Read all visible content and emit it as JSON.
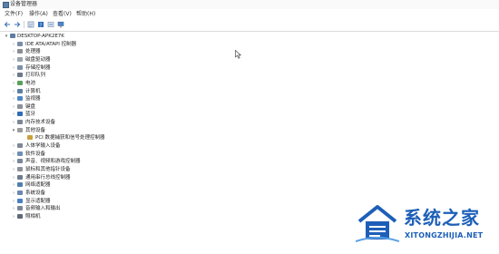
{
  "window": {
    "title": "设备管理器",
    "icon": "device-manager-icon"
  },
  "menu": [
    "文件(F)",
    "操作(A)",
    "查看(V)",
    "帮助(H)"
  ],
  "toolbar": {
    "buttons": [
      "back-arrow-icon",
      "forward-arrow-icon",
      "properties-icon",
      "help-icon",
      "update-driver-icon",
      "monitor-icon"
    ]
  },
  "tree": {
    "root": "DESKTOP-APK2E7K",
    "root_icon": "computer-icon",
    "items": [
      {
        "label": "IDE ATA/ATAPI 控制器",
        "icon": "ide-controller-icon",
        "expanded": false
      },
      {
        "label": "处理器",
        "icon": "processor-icon",
        "expanded": false
      },
      {
        "label": "磁盘驱动器",
        "icon": "disk-drive-icon",
        "expanded": false
      },
      {
        "label": "存储控制器",
        "icon": "storage-controller-icon",
        "expanded": false
      },
      {
        "label": "打印队列",
        "icon": "printer-icon",
        "expanded": false
      },
      {
        "label": "电池",
        "icon": "battery-icon",
        "expanded": false
      },
      {
        "label": "计算机",
        "icon": "computer-icon",
        "expanded": false
      },
      {
        "label": "监视器",
        "icon": "monitor-icon",
        "expanded": false
      },
      {
        "label": "键盘",
        "icon": "keyboard-icon",
        "expanded": false
      },
      {
        "label": "蓝牙",
        "icon": "bluetooth-icon",
        "expanded": false
      },
      {
        "label": "内存技术设备",
        "icon": "memory-device-icon",
        "expanded": false
      },
      {
        "label": "其他设备",
        "icon": "unknown-device-icon",
        "expanded": true,
        "children": [
          {
            "label": "PCI 数据捕获和信号处理控制器",
            "icon": "warning-device-icon"
          }
        ]
      },
      {
        "label": "人体学输入设备",
        "icon": "hid-icon",
        "expanded": false
      },
      {
        "label": "软件设备",
        "icon": "software-device-icon",
        "expanded": false
      },
      {
        "label": "声音、视频和游戏控制器",
        "icon": "sound-icon",
        "expanded": false
      },
      {
        "label": "鼠标和其他指针设备",
        "icon": "mouse-icon",
        "expanded": false
      },
      {
        "label": "通用串行总线控制器",
        "icon": "usb-icon",
        "expanded": false
      },
      {
        "label": "网络适配器",
        "icon": "network-adapter-icon",
        "expanded": false
      },
      {
        "label": "系统设备",
        "icon": "system-device-icon",
        "expanded": false
      },
      {
        "label": "显示适配器",
        "icon": "display-adapter-icon",
        "expanded": false
      },
      {
        "label": "音频输入和输出",
        "icon": "audio-io-icon",
        "expanded": false
      },
      {
        "label": "照相机",
        "icon": "camera-icon",
        "expanded": false
      }
    ]
  },
  "watermark": {
    "name": "系统之家",
    "url": "XITONGZHIJIA.NET",
    "color": "#1d5fb8"
  }
}
